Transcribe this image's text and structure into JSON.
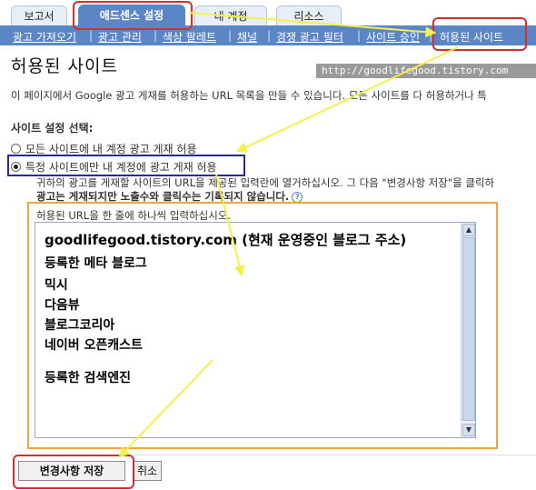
{
  "tabs": [
    {
      "label": "보고서"
    },
    {
      "label": "애드센스 설정"
    },
    {
      "label": "내 계정"
    },
    {
      "label": "리소스"
    }
  ],
  "subnav": [
    {
      "label": "광고 가져오기"
    },
    {
      "label": "광고 관리"
    },
    {
      "label": "색상 팔레트"
    },
    {
      "label": "채널"
    },
    {
      "label": "경쟁 광고 필터"
    },
    {
      "label": "사이트 승인"
    },
    {
      "label": "허용된 사이트"
    }
  ],
  "page": {
    "title": "허용된 사이트",
    "watermark": "http://goodlifegood.tistory.com",
    "description": "이 페이지에서 Google 광고 게재를 허용하는 URL 목록을 만들 수 있습니다. 모든 사이트를 다 허용하거나 특",
    "section_label": "사이트 설정 선택:"
  },
  "radio": {
    "all": "모든 사이트에 내 계정 광고 게재 허용",
    "specific": "특정 사이트에만 내 계정에 광고 게재 허용"
  },
  "help": {
    "line1": "귀하의 광고를 게재할 사이트의 URL을 제공된 입력란에 열거하십시오. 그 다음 \"변경사항 저장\"을 클릭하",
    "line2": "광고는 게재되지만 노출수와 클릭수는 기록되지 않습니다.",
    "icon": "?"
  },
  "textarea": {
    "label": "허용된 URL을 한 줄에 하나씩 입력하십시오.",
    "lines": [
      "goodlifegood.tistory.com (현재 운영중인 블로그 주소)",
      "등록한 메타 블로그",
      "믹시",
      "다음뷰",
      "블로그코리아",
      "네이버 오픈캐스트",
      "등록한 검색엔진"
    ]
  },
  "buttons": {
    "save": "변경사항 저장",
    "cancel": "취소"
  },
  "colors": {
    "nav_blue": "#5b86c6",
    "annotation_red": "#d03030",
    "annotation_yellow": "#f5f04a",
    "annotation_orange": "#f0a640",
    "annotation_navy": "#2a2a8a"
  }
}
